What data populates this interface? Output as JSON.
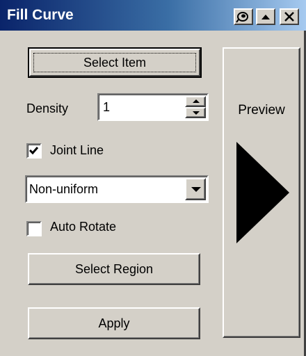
{
  "window": {
    "title": "Fill Curve",
    "title_icons": [
      "pin-icon",
      "minimize-icon",
      "close-icon"
    ]
  },
  "buttons": {
    "select_item": "Select Item",
    "select_region": "Select Region",
    "apply": "Apply"
  },
  "density": {
    "label": "Density",
    "value": "1"
  },
  "joint_line": {
    "label": "Joint Line",
    "checked": true
  },
  "mode_select": {
    "selected": "Non-uniform"
  },
  "auto_rotate": {
    "label": "Auto Rotate",
    "checked": false
  },
  "preview": {
    "label": "Preview",
    "icon": "play-arrow-icon"
  },
  "colors": {
    "face": "#d4d0c8",
    "title_start": "#0a246a",
    "title_end": "#a6caf0"
  }
}
